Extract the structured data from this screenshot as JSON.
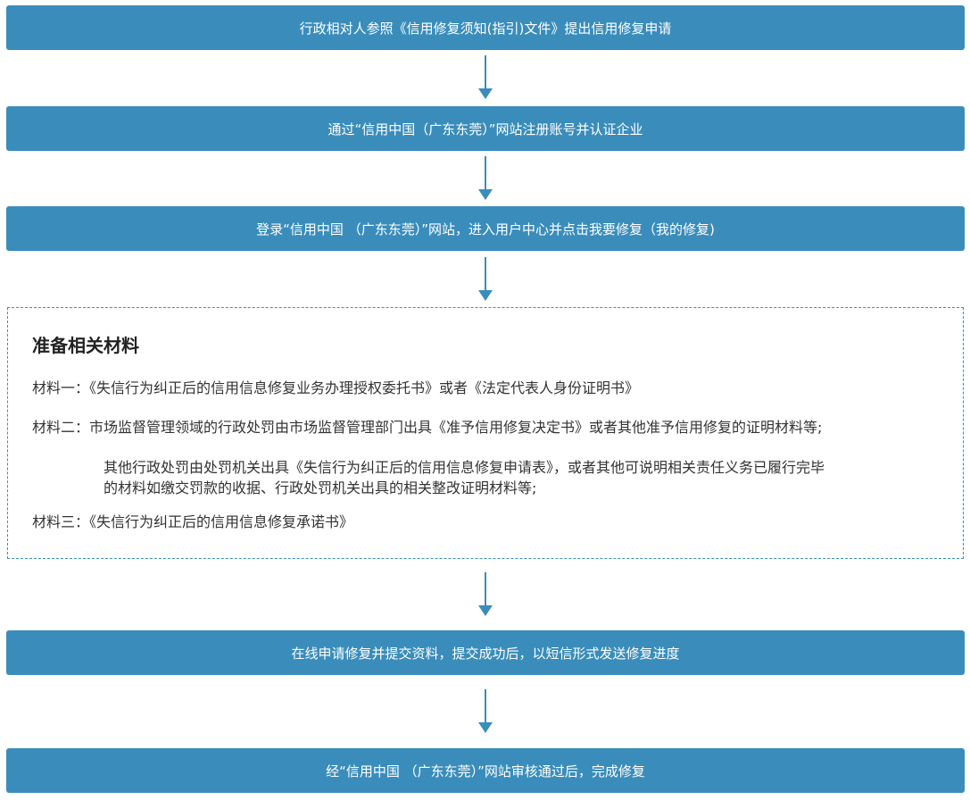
{
  "steps": [
    "行政相对人参照《信用修复须知(指引)文件》提出信用修复申请",
    "通过“信用中国（广东东莞）”网站注册账号并认证企业",
    "登录“信用中国 （广东东莞）”网站，进入用户中心并点击我要修复（我的修复)",
    "在线申请修复并提交资料，提交成功后，以短信形式发送修复进度",
    "经“信用中国 （广东东莞）”网站审核通过后，完成修复"
  ],
  "materials": {
    "title": "准备相关材料",
    "item1": "材料一：《失信行为纠正后的信用信息修复业务办理授权委托书》或者《法定代表人身份证明书》",
    "item2": "材料二：市场监督管理领域的行政处罚由市场监督管理部门出具《准予信用修复决定书》或者其他准予信用修复的证明材料等;",
    "item2_sub_line1": "其他行政处罚由处罚机关出具《失信行为纠正后的信用信息修复申请表》，或者其他可说明相关责任义务已履行完毕",
    "item2_sub_line2": "的材料如缴交罚款的收据、行政处罚机关出具的相关整改证明材料等;",
    "item3": "材料三：《失信行为纠正后的信用信息修复承诺书》"
  },
  "colors": {
    "step_bg": "#3a8dbb",
    "arrow": "#3a8dbb",
    "border": "#3a8dbb",
    "text": "#333333"
  }
}
